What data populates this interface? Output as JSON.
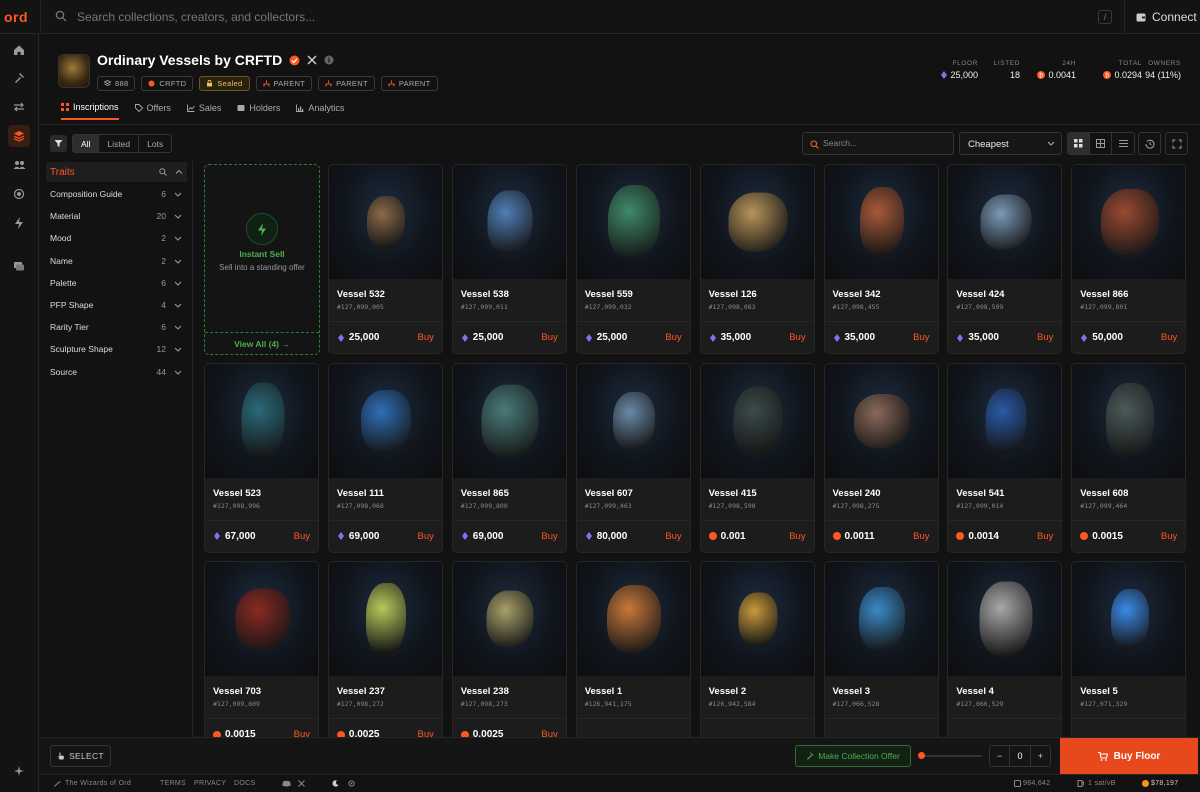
{
  "app": {
    "logo": "ord"
  },
  "search": {
    "placeholder": "Search collections, creators, and collectors...",
    "shortcut": "/"
  },
  "connect_label": "Connect",
  "collection": {
    "title": "Ordinary Vessels by CRFTD",
    "badges": [
      {
        "label": "888",
        "icon": "layers-icon"
      },
      {
        "label": "CRFTD",
        "icon": "crftd-icon"
      },
      {
        "label": "Sealed",
        "icon": "lock-icon"
      },
      {
        "label": "PARENT",
        "icon": "parent-icon"
      },
      {
        "label": "PARENT",
        "icon": "parent-icon"
      },
      {
        "label": "PARENT",
        "icon": "parent-icon"
      }
    ],
    "stats": [
      {
        "label": "FLOOR",
        "value": "25,000",
        "icon": "rune"
      },
      {
        "label": "LISTED",
        "value": "18",
        "icon": ""
      },
      {
        "label": "24H",
        "value": "0.0041",
        "icon": "btc"
      },
      {
        "label": "TOTAL",
        "value": "0.0294",
        "icon": "btc"
      },
      {
        "label": "OWNERS",
        "value": "94 (11%)",
        "icon": ""
      }
    ],
    "tabs": [
      {
        "label": "Inscriptions",
        "icon": "grid-icon",
        "active": true
      },
      {
        "label": "Offers",
        "icon": "tag-icon",
        "active": false
      },
      {
        "label": "Sales",
        "icon": "chart-icon",
        "active": false
      },
      {
        "label": "Holders",
        "icon": "wallet-icon",
        "active": false
      },
      {
        "label": "Analytics",
        "icon": "analytics-icon",
        "active": false
      }
    ]
  },
  "filters": {
    "segments": [
      "All",
      "Listed",
      "Lots"
    ],
    "search_placeholder": "Search...",
    "sort": "Cheapest"
  },
  "traits": {
    "title": "Traits",
    "items": [
      {
        "name": "Composition Guide",
        "count": "6"
      },
      {
        "name": "Material",
        "count": "20"
      },
      {
        "name": "Mood",
        "count": "2"
      },
      {
        "name": "Name",
        "count": "2"
      },
      {
        "name": "Palette",
        "count": "6"
      },
      {
        "name": "PFP Shape",
        "count": "4"
      },
      {
        "name": "Rarity Tier",
        "count": "6"
      },
      {
        "name": "Sculpture Shape",
        "count": "12"
      },
      {
        "name": "Source",
        "count": "44"
      }
    ]
  },
  "instant_sell": {
    "title": "Instant Sell",
    "subtitle": "Sell into a standing offer",
    "link": "View All (4) →"
  },
  "buy_label": "Buy",
  "items": [
    {
      "name": "Vessel 532",
      "id": "#127,099,005",
      "price": "25,000",
      "currency": "rune",
      "color": "#8a6a4a"
    },
    {
      "name": "Vessel 538",
      "id": "#127,099,011",
      "price": "25,000",
      "currency": "rune",
      "color": "#4f7fb8"
    },
    {
      "name": "Vessel 559",
      "id": "#127,099,032",
      "price": "25,000",
      "currency": "rune",
      "color": "#3f8a6a"
    },
    {
      "name": "Vessel 126",
      "id": "#127,098,083",
      "price": "35,000",
      "currency": "rune",
      "color": "#b8955a"
    },
    {
      "name": "Vessel 342",
      "id": "#127,098,455",
      "price": "35,000",
      "currency": "rune",
      "color": "#a85a3a"
    },
    {
      "name": "Vessel 424",
      "id": "#127,098,599",
      "price": "35,000",
      "currency": "rune",
      "color": "#7a9ab8"
    },
    {
      "name": "Vessel 866",
      "id": "#127,099,801",
      "price": "50,000",
      "currency": "rune",
      "color": "#9a4a32"
    },
    {
      "name": "Vessel 523",
      "id": "#127,098,996",
      "price": "67,000",
      "currency": "rune",
      "color": "#2a6a7a"
    },
    {
      "name": "Vessel 111",
      "id": "#127,098,068",
      "price": "69,000",
      "currency": "rune",
      "color": "#2f6fb8"
    },
    {
      "name": "Vessel 865",
      "id": "#127,099,800",
      "price": "69,000",
      "currency": "rune",
      "color": "#4a7a7a"
    },
    {
      "name": "Vessel 607",
      "id": "#127,099,463",
      "price": "80,000",
      "currency": "rune",
      "color": "#6a8aa8"
    },
    {
      "name": "Vessel 415",
      "id": "#127,098,590",
      "price": "0.001",
      "currency": "btc",
      "color": "#3a4a4a"
    },
    {
      "name": "Vessel 240",
      "id": "#127,098,275",
      "price": "0.0011",
      "currency": "btc",
      "color": "#8a6a5a"
    },
    {
      "name": "Vessel 541",
      "id": "#127,099,014",
      "price": "0.0014",
      "currency": "btc",
      "color": "#2a5aa8"
    },
    {
      "name": "Vessel 608",
      "id": "#127,099,464",
      "price": "0.0015",
      "currency": "btc",
      "color": "#4a5a5a"
    },
    {
      "name": "Vessel 703",
      "id": "#127,099,609",
      "price": "0.0015",
      "currency": "btc",
      "color": "#8a2a22"
    },
    {
      "name": "Vessel 237",
      "id": "#127,098,272",
      "price": "0.0025",
      "currency": "btc",
      "color": "#b8c85a"
    },
    {
      "name": "Vessel 238",
      "id": "#127,098,273",
      "price": "0.0025",
      "currency": "btc",
      "color": "#a8a06a"
    },
    {
      "name": "Vessel 1",
      "id": "#126,941,175",
      "price": "",
      "currency": "",
      "color": "#c8783a"
    },
    {
      "name": "Vessel 2",
      "id": "#126,942,584",
      "price": "",
      "currency": "",
      "color": "#c89a3a"
    },
    {
      "name": "Vessel 3",
      "id": "#127,066,528",
      "price": "",
      "currency": "",
      "color": "#3a8ac8"
    },
    {
      "name": "Vessel 4",
      "id": "#127,066,529",
      "price": "",
      "currency": "",
      "color": "#a8a8a8"
    },
    {
      "name": "Vessel 5",
      "id": "#127,071,329",
      "price": "",
      "currency": "",
      "color": "#3a8ae8"
    }
  ],
  "bottom": {
    "select_label": "SELECT",
    "offer_label": "Make Collection Offer",
    "quantity": "0",
    "minus": "−",
    "plus": "+",
    "buy_floor_label": "Buy Floor"
  },
  "footer": {
    "brand": "The Wizards of Ord",
    "terms": "TERMS",
    "privacy": "PRIVACY",
    "docs": "DOCS",
    "block": "964,642",
    "fee": "1 sat/vB",
    "btc_price": "$78,197"
  },
  "colors": {
    "accent": "#ff5722",
    "green": "#4caf50",
    "btc": "#f7931a",
    "rune": "#8b6cf0"
  }
}
